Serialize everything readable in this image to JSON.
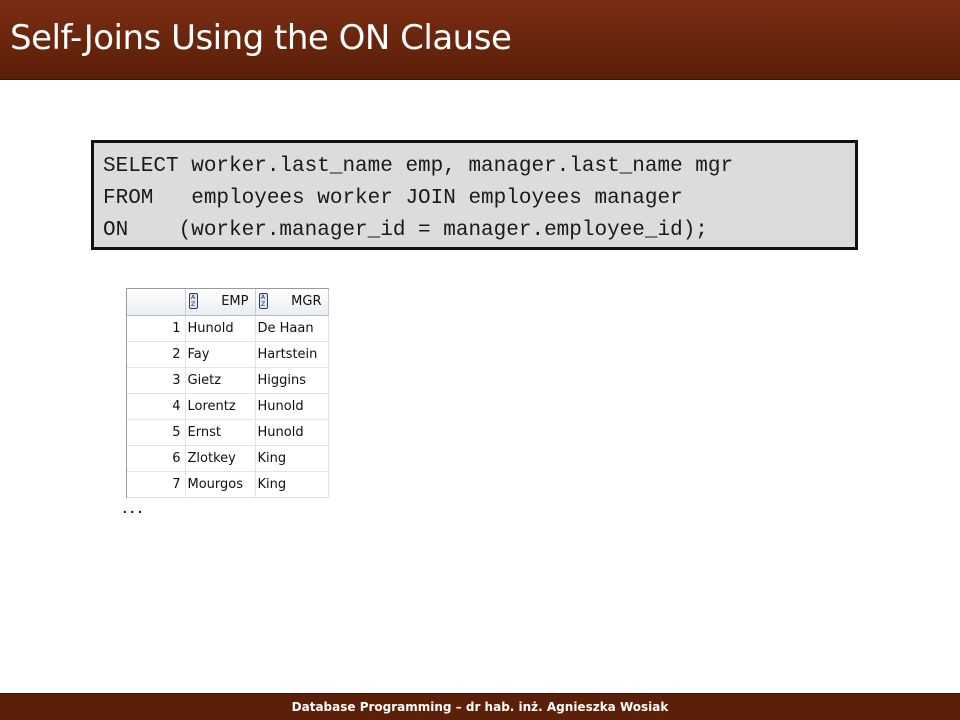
{
  "slide": {
    "title": "Self-Joins Using the ON Clause",
    "footer": "Database Programming – dr hab. inż. Agnieszka Wosiak"
  },
  "code": {
    "lines": [
      "SELECT worker.last_name emp, manager.last_name mgr",
      "FROM   employees worker JOIN employees manager",
      "ON    (worker.manager_id = manager.employee_id);"
    ]
  },
  "results": {
    "columns": [
      {
        "label": "EMP",
        "icon": "sort-az-icon"
      },
      {
        "label": "MGR",
        "icon": "sort-az-icon"
      }
    ],
    "rows": [
      {
        "num": "1",
        "emp": "Hunold",
        "mgr": "De Haan"
      },
      {
        "num": "2",
        "emp": "Fay",
        "mgr": "Hartstein"
      },
      {
        "num": "3",
        "emp": "Gietz",
        "mgr": "Higgins"
      },
      {
        "num": "4",
        "emp": "Lorentz",
        "mgr": "Hunold"
      },
      {
        "num": "5",
        "emp": "Ernst",
        "mgr": "Hunold"
      },
      {
        "num": "6",
        "emp": "Zlotkey",
        "mgr": "King"
      },
      {
        "num": "7",
        "emp": "Mourgos",
        "mgr": "King"
      }
    ],
    "continuation": "..."
  },
  "colors": {
    "title_bar": "#6a250c",
    "footer_bar": "#5c1f08",
    "code_background": "#dcdcdc"
  }
}
